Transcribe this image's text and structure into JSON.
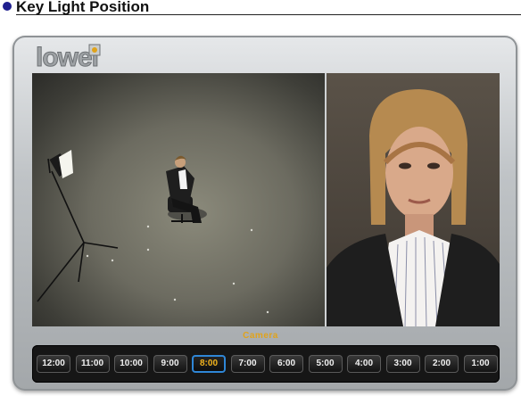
{
  "header": {
    "title": "Key Light Position"
  },
  "logo": {
    "text": "lowel"
  },
  "camera_label": "Camera",
  "times": [
    "12:00",
    "11:00",
    "10:00",
    "9:00",
    "8:00",
    "7:00",
    "6:00",
    "5:00",
    "4:00",
    "3:00",
    "2:00",
    "1:00"
  ],
  "selected_time": "8:00",
  "colors": {
    "accent": "#f3b41c",
    "selection": "#2f86d6",
    "bullet": "#1f1f8f"
  }
}
